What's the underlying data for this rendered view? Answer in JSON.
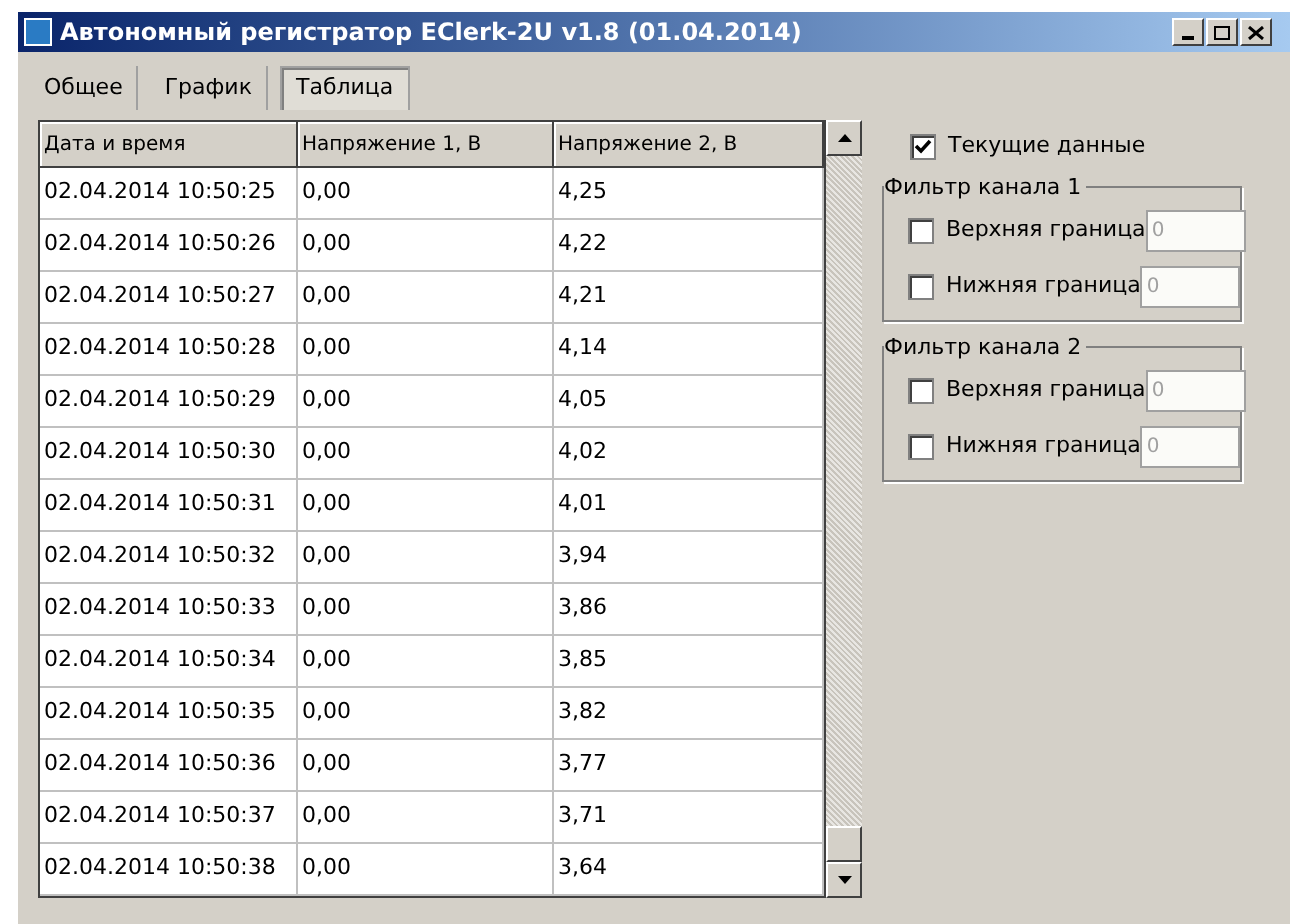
{
  "window": {
    "title": "Автономный регистратор EClerk-2U v1.8 (01.04.2014)"
  },
  "tabs": [
    {
      "label": "Общее",
      "selected": false
    },
    {
      "label": "График",
      "selected": false
    },
    {
      "label": "Таблица",
      "selected": true
    }
  ],
  "table": {
    "columns": [
      "Дата и время",
      "Напряжение 1, В",
      "Напряжение 2, В"
    ],
    "rows": [
      [
        "02.04.2014 10:50:25",
        "0,00",
        "4,25"
      ],
      [
        "02.04.2014 10:50:26",
        "0,00",
        "4,22"
      ],
      [
        "02.04.2014 10:50:27",
        "0,00",
        "4,21"
      ],
      [
        "02.04.2014 10:50:28",
        "0,00",
        "4,14"
      ],
      [
        "02.04.2014 10:50:29",
        "0,00",
        "4,05"
      ],
      [
        "02.04.2014 10:50:30",
        "0,00",
        "4,02"
      ],
      [
        "02.04.2014 10:50:31",
        "0,00",
        "4,01"
      ],
      [
        "02.04.2014 10:50:32",
        "0,00",
        "3,94"
      ],
      [
        "02.04.2014 10:50:33",
        "0,00",
        "3,86"
      ],
      [
        "02.04.2014 10:50:34",
        "0,00",
        "3,85"
      ],
      [
        "02.04.2014 10:50:35",
        "0,00",
        "3,82"
      ],
      [
        "02.04.2014 10:50:36",
        "0,00",
        "3,77"
      ],
      [
        "02.04.2014 10:50:37",
        "0,00",
        "3,71"
      ],
      [
        "02.04.2014 10:50:38",
        "0,00",
        "3,64"
      ]
    ]
  },
  "current_data": {
    "label": "Текущие данные",
    "checked": true
  },
  "filters": [
    {
      "title": "Фильтр канала 1",
      "bounds": [
        {
          "label": "Верхняя граница",
          "checked": false,
          "value": "0",
          "disabled": true
        },
        {
          "label": "Нижняя граница",
          "checked": false,
          "value": "0",
          "disabled": true
        }
      ]
    },
    {
      "title": "Фильтр канала 2",
      "bounds": [
        {
          "label": "Верхняя граница",
          "checked": false,
          "value": "0",
          "disabled": true
        },
        {
          "label": "Нижняя граница",
          "checked": false,
          "value": "0",
          "disabled": true
        }
      ]
    }
  ]
}
